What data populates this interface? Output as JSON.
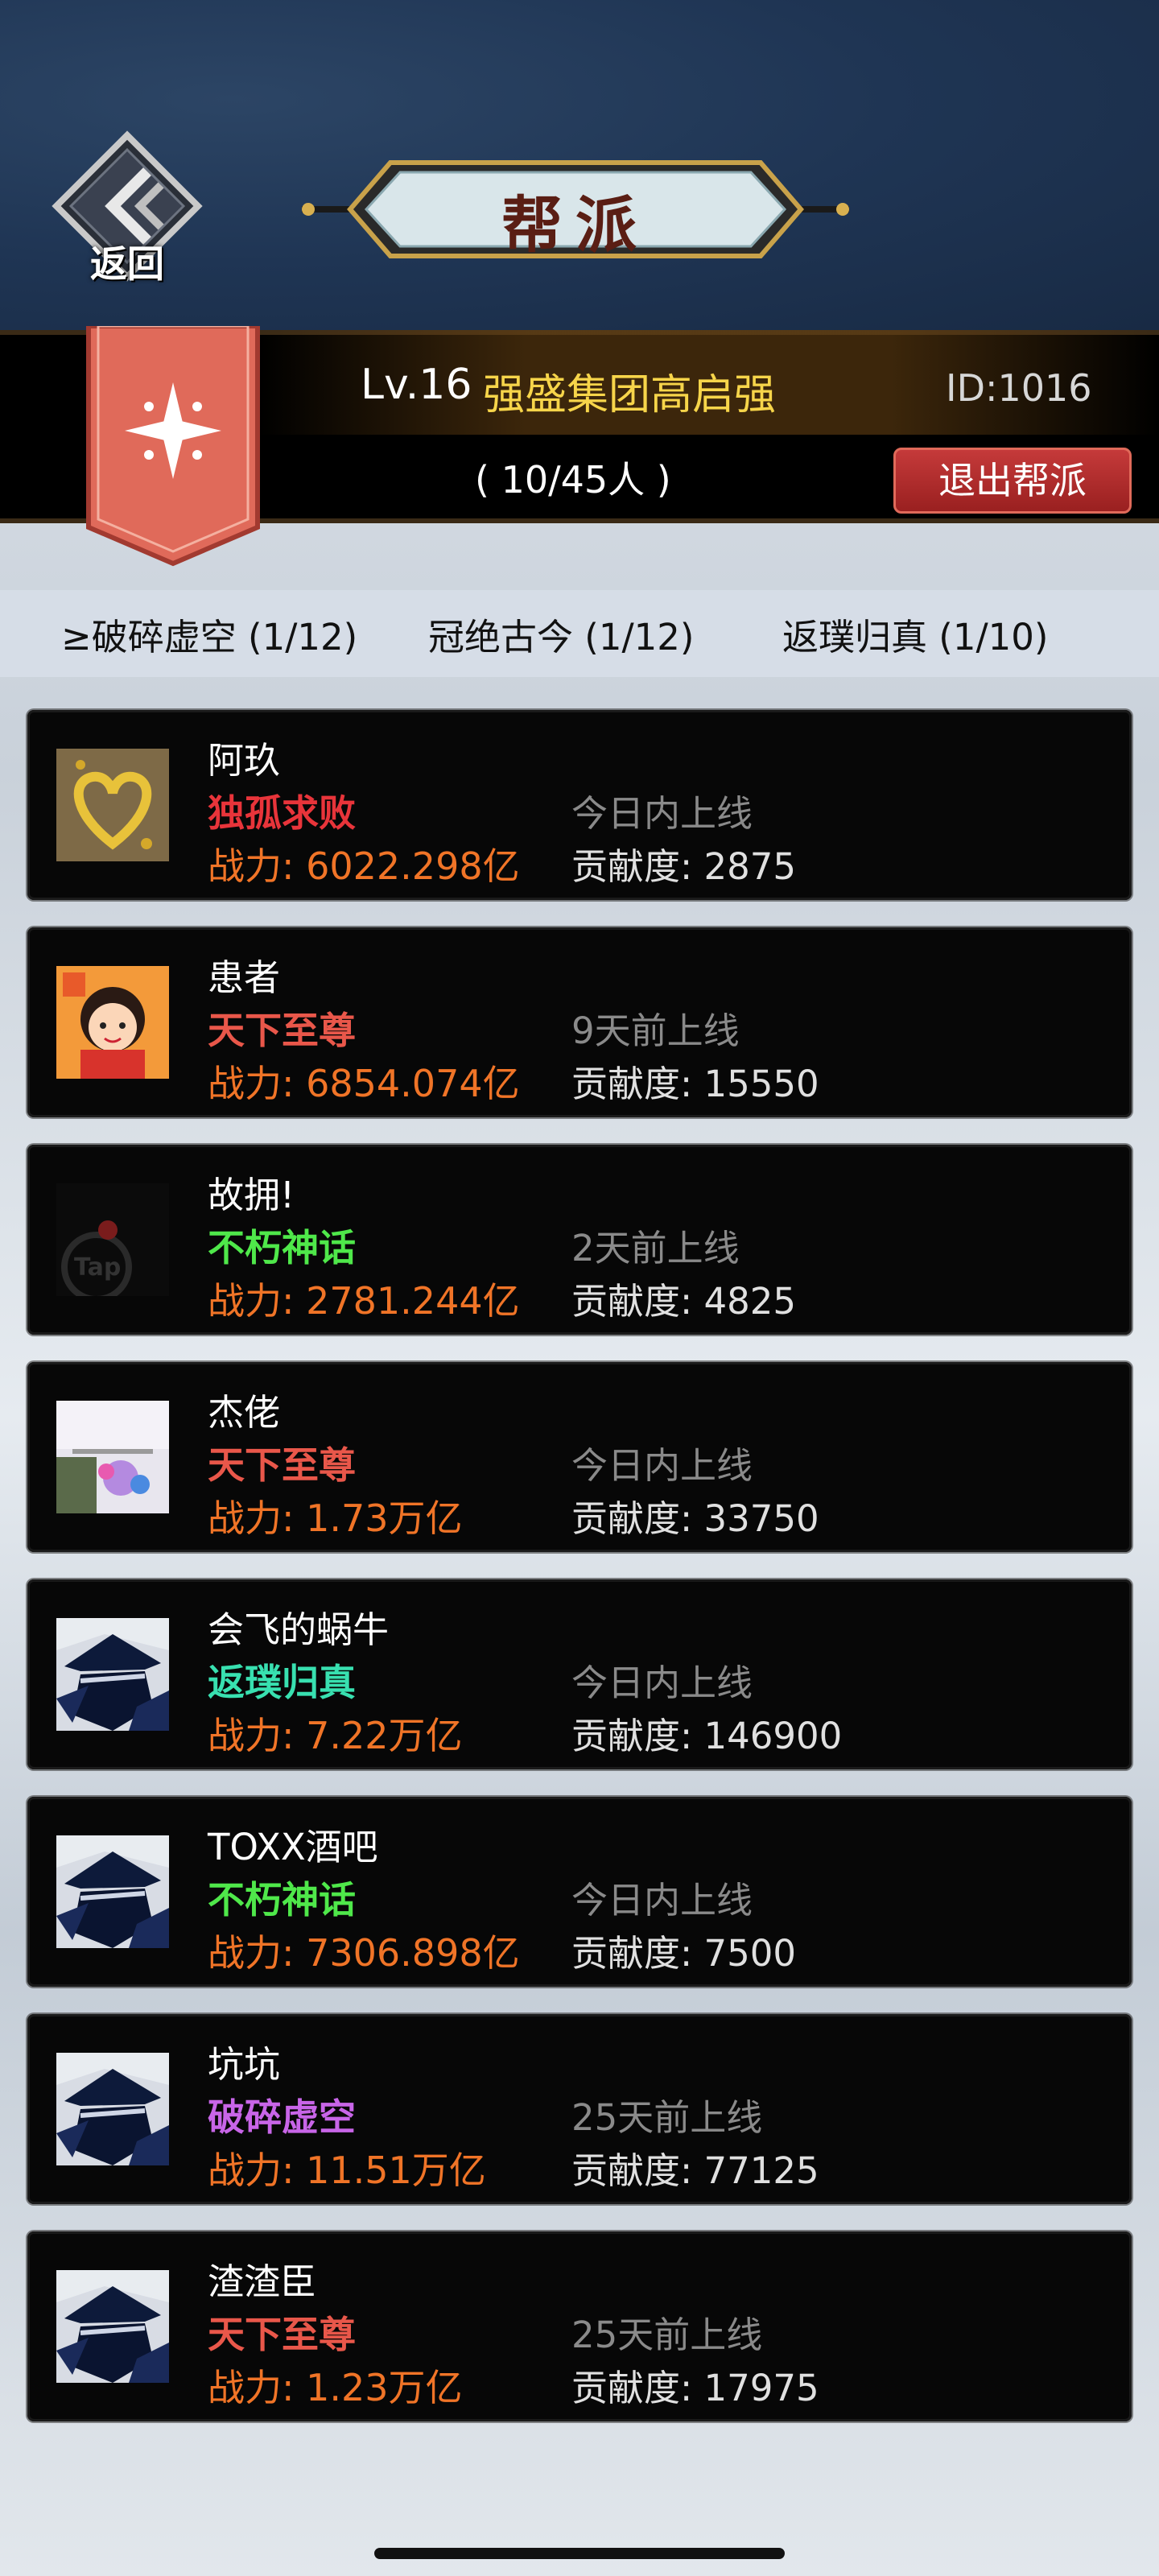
{
  "header": {
    "back_label": "返回",
    "title": "帮派"
  },
  "guild": {
    "level": "Lv.16",
    "name": "强盛集团高启强",
    "id": "ID:1016",
    "member_count": "( 10/45人 )",
    "exit_label": "退出帮派"
  },
  "rank_tabs": [
    {
      "label": "≥破碎虚空 (1/12)"
    },
    {
      "label": "冠绝古今 (1/12)"
    },
    {
      "label": "返璞归真 (1/10)"
    }
  ],
  "members": [
    {
      "name": "阿玖",
      "rank": "独孤求败",
      "rank_color": "#e8343a",
      "power": "战力: 6022.298亿",
      "status": "今日内上线",
      "contribution": "贡献度: 2875",
      "avatar": "ginkgo-leaves-heart-photo"
    },
    {
      "name": "患者",
      "rank": "天下至尊",
      "rank_color": "#e9574a",
      "power": "战力: 6854.074亿",
      "status": "9天前上线",
      "contribution": "贡献度: 15550",
      "avatar": "cartoon-boy-avatar"
    },
    {
      "name": "故拥!",
      "rank": "不朽神话",
      "rank_color": "#4fe84a",
      "power": "战力: 2781.244亿",
      "status": "2天前上线",
      "contribution": "贡献度: 4825",
      "avatar": "taptap-logo-avatar"
    },
    {
      "name": "杰佬",
      "rank": "天下至尊",
      "rank_color": "#e9574a",
      "power": "战力: 1.73万亿",
      "status": "今日内上线",
      "contribution": "贡献度: 33750",
      "avatar": "blurry-photo-avatar"
    },
    {
      "name": "会飞的蜗牛",
      "rank": "返璞归真",
      "rank_color": "#38e0b0",
      "power": "战力: 7.22万亿",
      "status": "今日内上线",
      "contribution": "贡献度: 146900",
      "avatar": "ninja-default-avatar"
    },
    {
      "name": "TOXX酒吧",
      "rank": "不朽神话",
      "rank_color": "#4fe84a",
      "power": "战力: 7306.898亿",
      "status": "今日内上线",
      "contribution": "贡献度: 7500",
      "avatar": "ninja-default-avatar"
    },
    {
      "name": "坑坑",
      "rank": "破碎虚空",
      "rank_color": "#c865e8",
      "power": "战力: 11.51万亿",
      "status": "25天前上线",
      "contribution": "贡献度: 77125",
      "avatar": "ninja-default-avatar"
    },
    {
      "name": "渣渣臣",
      "rank": "天下至尊",
      "rank_color": "#e9574a",
      "power": "战力: 1.23万亿",
      "status": "25天前上线",
      "contribution": "贡献度: 17975",
      "avatar": "ninja-default-avatar"
    }
  ]
}
